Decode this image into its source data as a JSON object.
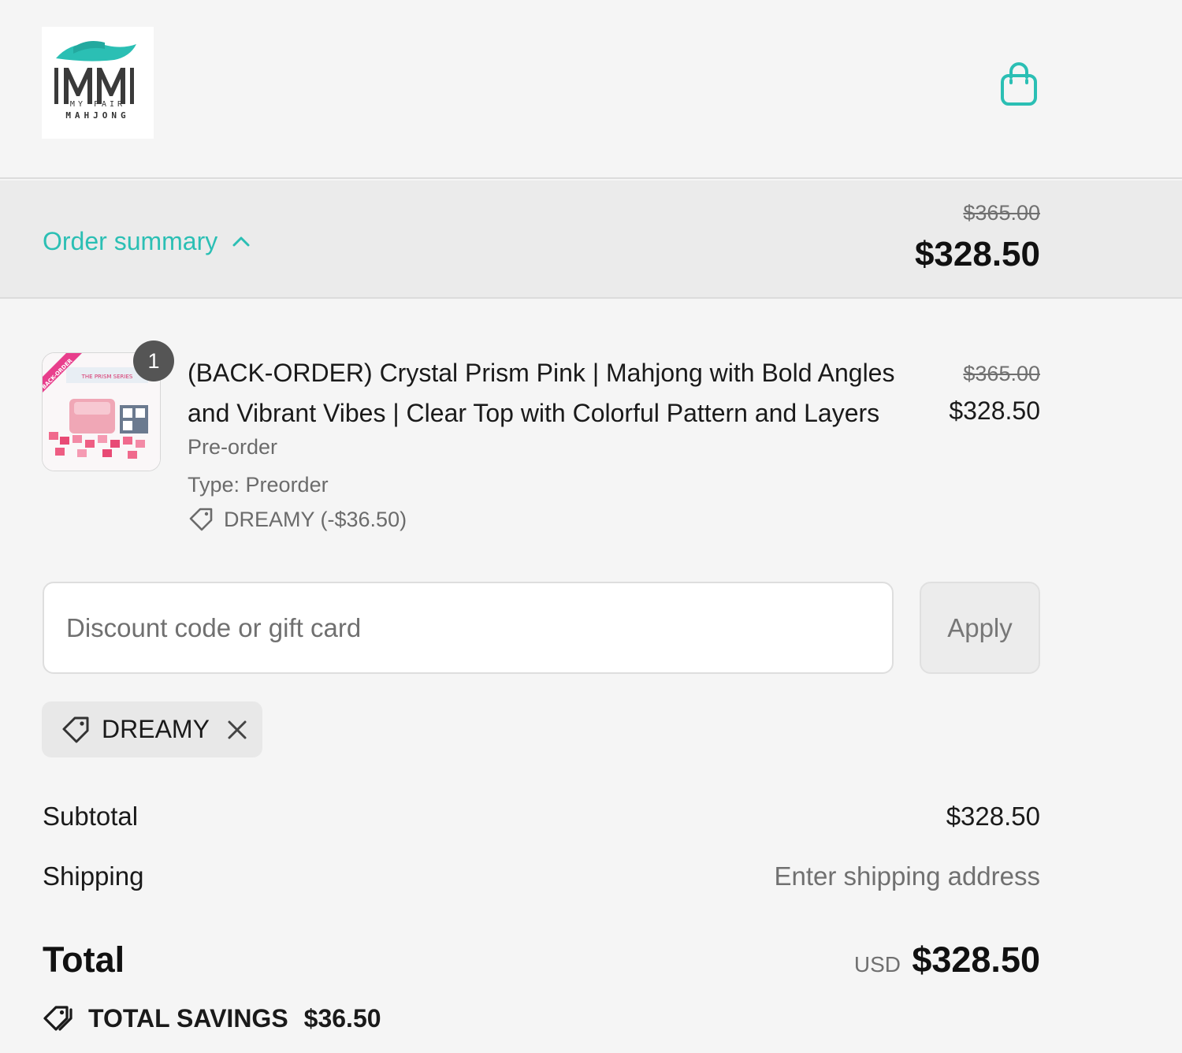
{
  "header": {
    "logo_text_top": "MY FAIR",
    "logo_text_bottom": "MAHJONG",
    "cart_icon": "shopping-bag-icon",
    "accent_color": "#2bbfb4"
  },
  "summary_bar": {
    "toggle_label": "Order summary",
    "toggle_icon": "chevron-up-icon",
    "original_total": "$365.00",
    "total": "$328.50"
  },
  "line_item": {
    "quantity": "1",
    "title": "(BACK-ORDER) Crystal Prism Pink | Mahjong with Bold Angles and Vibrant Vibes | Clear Top with Colorful Pattern and Layers",
    "variant": "Pre-order",
    "type": "Type: Preorder",
    "discount": "DREAMY (-$36.50)",
    "original_price": "$365.00",
    "price": "$328.50",
    "thumbnail_ribbon": "BACK-ORDER",
    "thumbnail_banner": "THE PRISM SERIES"
  },
  "discount_form": {
    "placeholder": "Discount code or gift card",
    "apply_label": "Apply"
  },
  "applied_code": {
    "code": "DREAMY"
  },
  "totals": {
    "subtotal_label": "Subtotal",
    "subtotal_value": "$328.50",
    "shipping_label": "Shipping",
    "shipping_value": "Enter shipping address",
    "total_label": "Total",
    "currency": "USD",
    "total_value": "$328.50",
    "savings_label": "TOTAL SAVINGS",
    "savings_value": "$36.50"
  }
}
